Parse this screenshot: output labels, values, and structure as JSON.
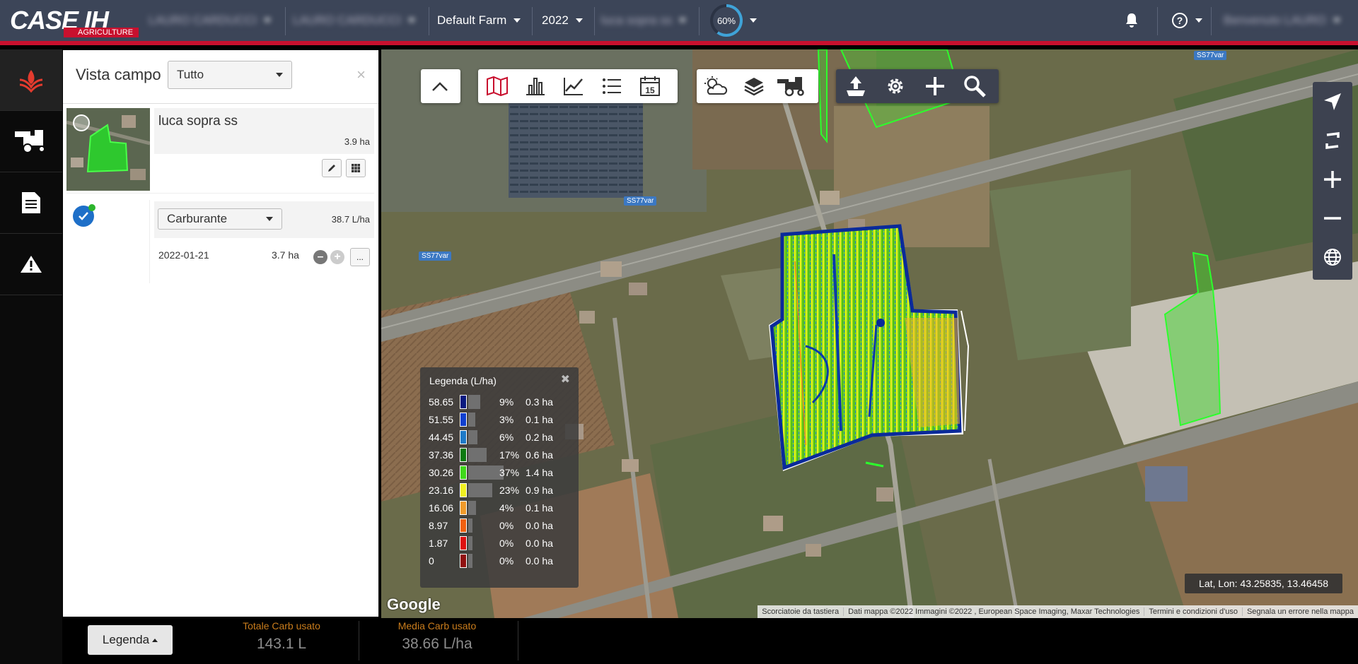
{
  "topbar": {
    "brand": "CASE IH",
    "brand_sub": "AGRICULTURE",
    "org1": "LAURO CARDUCCI",
    "org2": "LAURO CARDUCCI",
    "farm": "Default Farm",
    "year": "2022",
    "field": "luca sopra ss",
    "progress_label": "60%",
    "progress": 0.6,
    "user": "Benvenuto LAURO"
  },
  "nav": [
    "crop-icon",
    "harvester-icon",
    "document-icon",
    "alert-icon"
  ],
  "panel": {
    "title": "Vista campo",
    "filter_value": "Tutto",
    "field": {
      "name": "luca sopra ss",
      "area": "3.9 ha"
    },
    "operation": {
      "layer": "Carburante",
      "rate": "38.7 L/ha",
      "date": "2022-01-21",
      "area": "3.7 ha",
      "more": "..."
    }
  },
  "map": {
    "road1": "SS77var",
    "road2": "SS77var",
    "road3": "SS77var",
    "latlon": "Lat, Lon: 43.25835, 13.46458",
    "google": "Google",
    "attribution": [
      "Scorciatoie da tastiera",
      "Dati mappa ©2022 Immagini ©2022 , European Space Imaging, Maxar Technologies",
      "Termini e condizioni d'uso",
      "Segnala un errore nella mappa"
    ],
    "calendar_day": "15"
  },
  "legend": {
    "title": "Legenda (L/ha)",
    "rows": [
      {
        "value": "58.65",
        "color": "#0a1a80",
        "pct": "9%",
        "ha": "0.3 ha",
        "share": 9
      },
      {
        "value": "51.55",
        "color": "#1040d0",
        "pct": "3%",
        "ha": "0.1 ha",
        "share": 3
      },
      {
        "value": "44.45",
        "color": "#1e7ac8",
        "pct": "6%",
        "ha": "0.2 ha",
        "share": 6
      },
      {
        "value": "37.36",
        "color": "#0c7a10",
        "pct": "17%",
        "ha": "0.6 ha",
        "share": 17
      },
      {
        "value": "30.26",
        "color": "#3fd81a",
        "pct": "37%",
        "ha": "1.4 ha",
        "share": 37
      },
      {
        "value": "23.16",
        "color": "#f0f020",
        "pct": "23%",
        "ha": "0.9 ha",
        "share": 23
      },
      {
        "value": "16.06",
        "color": "#f09a2a",
        "pct": "4%",
        "ha": "0.1 ha",
        "share": 4
      },
      {
        "value": "8.97",
        "color": "#f06010",
        "pct": "0%",
        "ha": "0.0 ha",
        "share": 0
      },
      {
        "value": "1.87",
        "color": "#e01010",
        "pct": "0%",
        "ha": "0.0 ha",
        "share": 0
      },
      {
        "value": "0",
        "color": "#901010",
        "pct": "0%",
        "ha": "0.0 ha",
        "share": 0
      }
    ]
  },
  "bottom": {
    "legend_button": "Legenda",
    "total_label": "Totale Carb usato",
    "total_value": "143.1 L",
    "avg_label": "Media Carb usato",
    "avg_value": "38.66 L/ha"
  },
  "colors": {
    "accent": "#c8102e",
    "topbar": "#3c4558",
    "stat_label": "#c97c1c"
  }
}
